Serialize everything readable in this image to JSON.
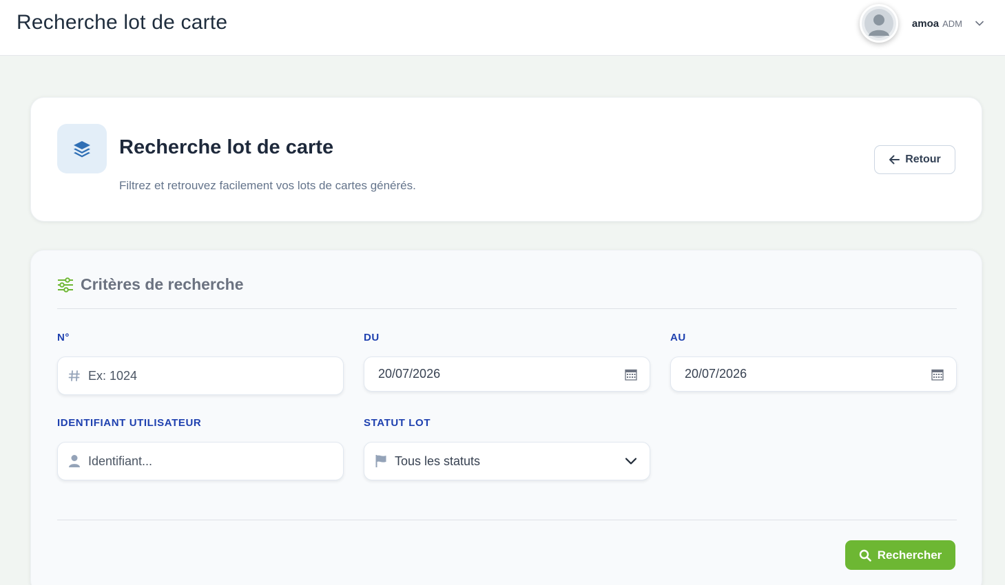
{
  "topbar": {
    "title": "Recherche lot de carte",
    "user": {
      "name": "amoa",
      "role": "ADM"
    }
  },
  "header": {
    "title": "Recherche lot de carte",
    "subtitle": "Filtrez et retrouvez facilement vos lots de cartes générés.",
    "back_label": "Retour"
  },
  "form": {
    "section_title": "Critères de recherche",
    "numero": {
      "label": "N°",
      "placeholder": "Ex: 1024"
    },
    "du": {
      "label": "DU",
      "value": "20/07/2026"
    },
    "au": {
      "label": "AU",
      "value": "20/07/2026"
    },
    "identifiant": {
      "label": "IDENTIFIANT UTILISATEUR",
      "placeholder": "Identifiant..."
    },
    "statut": {
      "label": "STATUT LOT",
      "selected": "Tous les statuts"
    },
    "search_label": "Rechercher"
  },
  "colors": {
    "accent_green": "#6db733",
    "label_blue": "#1e40af",
    "icon_blue": "#2f6fb5"
  }
}
